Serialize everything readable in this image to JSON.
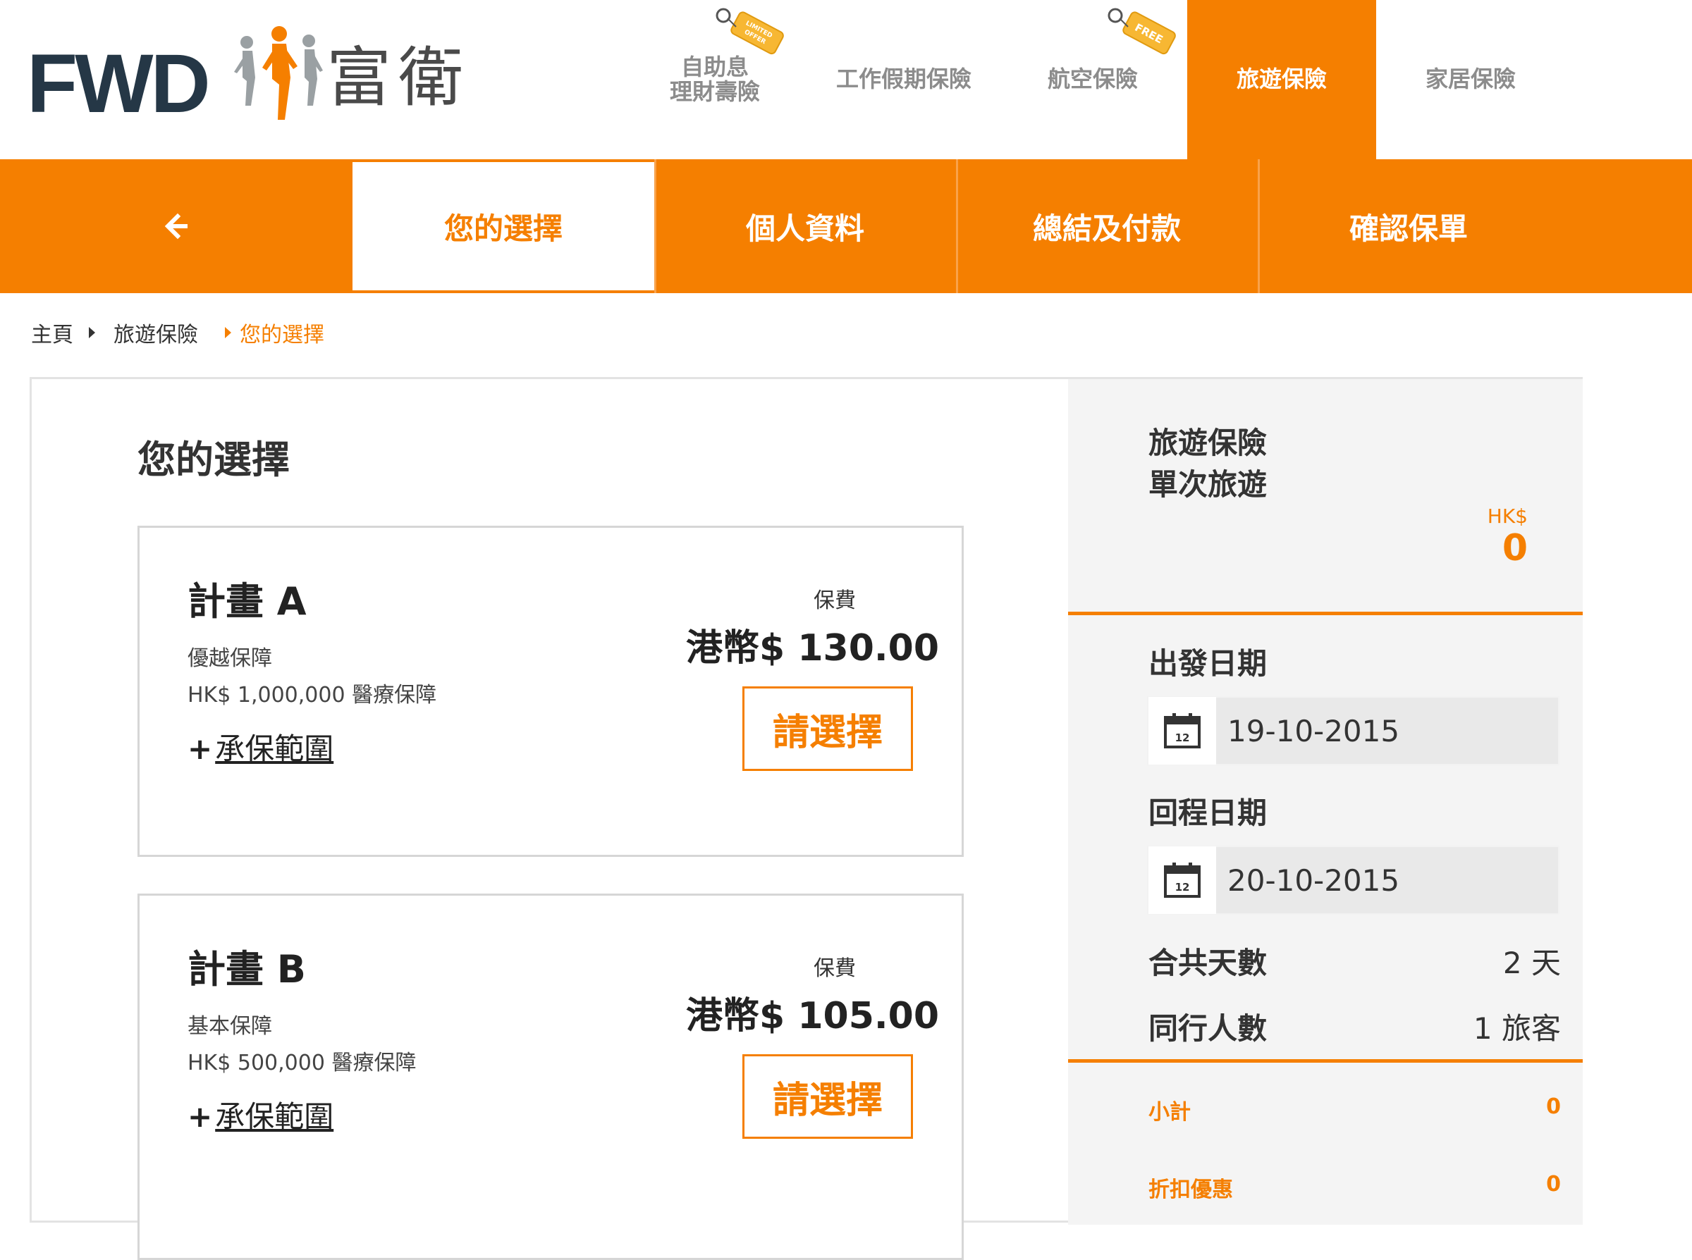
{
  "brand": {
    "logo_en": "FWD",
    "logo_cn": "富衛",
    "accent": "#f57f00",
    "navy": "#253746"
  },
  "topnav": {
    "items": [
      {
        "label_line1": "自助息",
        "label_line2": "理財壽險",
        "tag": "LIMITED OFFER"
      },
      {
        "label": "工作假期保險"
      },
      {
        "label": "航空保險",
        "tag": "FREE"
      },
      {
        "label": "旅遊保險",
        "active": true
      },
      {
        "label": "家居保險"
      }
    ]
  },
  "steps": {
    "back_icon": "arrow-left-icon",
    "items": [
      "您的選擇",
      "個人資料",
      "總結及付款",
      "確認保單"
    ]
  },
  "breadcrumb": {
    "home": "主頁",
    "section": "旅遊保險",
    "current": "您的選擇"
  },
  "main": {
    "title": "您的選擇",
    "plans": [
      {
        "name": "計畫 A",
        "tier": "優越保障",
        "cover": "HK$ 1,000,000 醫療保障",
        "link": "承保範圍",
        "premium_label": "保費",
        "premium": "港幣$ 130.00",
        "select": "請選擇"
      },
      {
        "name": "計畫 B",
        "tier": "基本保障",
        "cover": "HK$ 500,000 醫療保障",
        "link": "承保範圍",
        "premium_label": "保費",
        "premium": "港幣$ 105.00",
        "select": "請選擇"
      }
    ]
  },
  "summary": {
    "title_line1": "旅遊保險",
    "title_line2": "單次旅遊",
    "currency": "HK$",
    "total": "0",
    "departure_label": "出發日期",
    "departure_date": "19-10-2015",
    "return_label": "回程日期",
    "return_date": "20-10-2015",
    "calendar_day": "12",
    "days_label": "合共天數",
    "days_value": "2 天",
    "travellers_label": "同行人數",
    "travellers_value": "1 旅客",
    "subtotal_label": "小計",
    "subtotal_value": "0",
    "discount_label": "折扣優惠",
    "discount_value": "0"
  }
}
